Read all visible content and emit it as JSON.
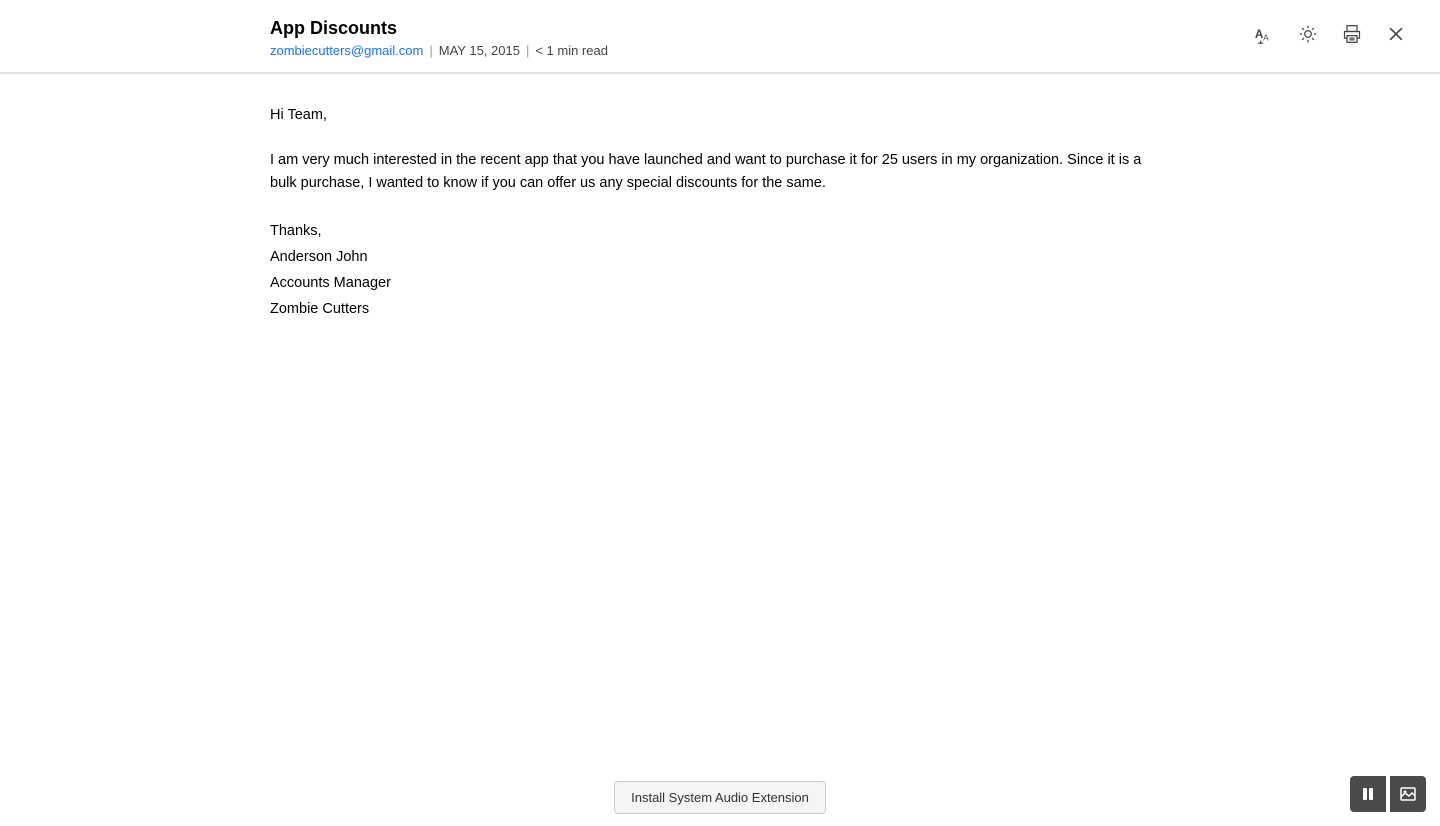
{
  "email": {
    "subject": "App Discounts",
    "from": "zombiecutters@gmail.com",
    "date": "MAY 15, 2015",
    "read_time": "< 1 min read",
    "separator": "|",
    "body": {
      "greeting": "Hi Team,",
      "paragraph1": "I am very much interested in the recent app that you have launched and want to purchase it for 25 users in my organization. Since it is a bulk purchase, I wanted to know if you can offer us any special discounts for the same.",
      "thanks": "Thanks,",
      "name": "Anderson John",
      "title": "Accounts Manager",
      "company": "Zombie Cutters"
    }
  },
  "toolbar": {
    "text_size_label": "text-size",
    "brightness_label": "brightness",
    "print_label": "print",
    "close_label": "close"
  },
  "bottom": {
    "install_btn_label": "Install System Audio Extension",
    "pause_btn_label": "⏸",
    "image_btn_label": "🖼"
  }
}
